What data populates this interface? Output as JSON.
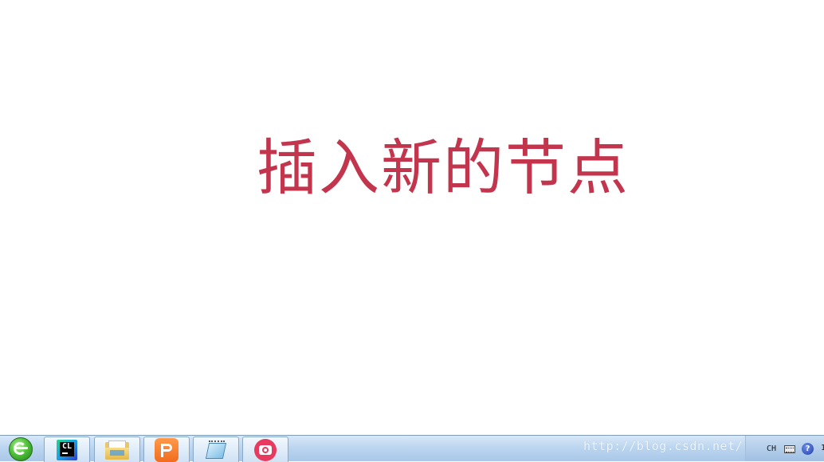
{
  "slide": {
    "title": "插入新的节点",
    "title_color": "#c3354d",
    "background": "#ffffff"
  },
  "taskbar": {
    "start_icon": "start-orb-icon",
    "apps": [
      {
        "name": "clion",
        "icon": "clion-icon",
        "label": "CL"
      },
      {
        "name": "file-explorer",
        "icon": "folder-icon"
      },
      {
        "name": "wps-presentation",
        "icon": "wps-presentation-icon"
      },
      {
        "name": "notepad",
        "icon": "notepad-icon"
      },
      {
        "name": "screen-recorder",
        "icon": "camera-icon"
      }
    ],
    "watermark": "http://blog.csdn.net/",
    "tray": {
      "language": "CH",
      "keyboard_icon": "keyboard-icon",
      "help_icon": "help-icon",
      "help_label": "?",
      "clock": "1"
    }
  }
}
